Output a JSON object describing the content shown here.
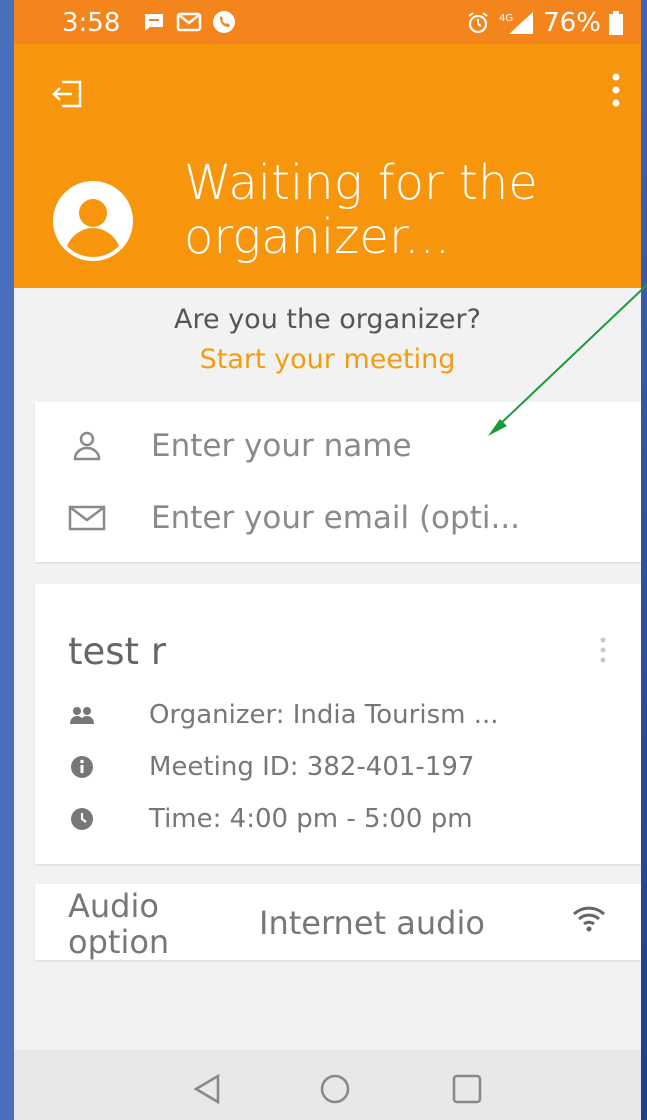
{
  "status_bar": {
    "time": "3:58",
    "battery": "76%",
    "network": "4G",
    "icons": [
      "message-icon",
      "gmail-icon",
      "phone-icon",
      "alarm-icon",
      "signal-icon",
      "battery-icon"
    ]
  },
  "header": {
    "title_line1": "Waiting for the",
    "title_line2": "organizer...",
    "icons": [
      "exit-icon",
      "more-options-icon",
      "avatar-icon"
    ]
  },
  "organizer_prompt": {
    "question": "Are you the organizer?",
    "link": "Start your meeting"
  },
  "inputs": {
    "name": {
      "placeholder": "Enter your name",
      "value": ""
    },
    "email": {
      "placeholder": "Enter your email (opti...",
      "value": ""
    }
  },
  "meeting": {
    "title": "test r",
    "organizer": "Organizer: India Tourism ...",
    "meeting_id": "Meeting ID: 382-401-197",
    "time": "Time: 4:00 pm - 5:00 pm"
  },
  "audio": {
    "label_line1": "Audio",
    "label_line2": "option",
    "value": "Internet audio"
  },
  "colors": {
    "header": "#f7960c",
    "status_bar": "#f4841c",
    "accent_link": "#f39c12",
    "annotation_arrow": "#1a9b3a"
  }
}
